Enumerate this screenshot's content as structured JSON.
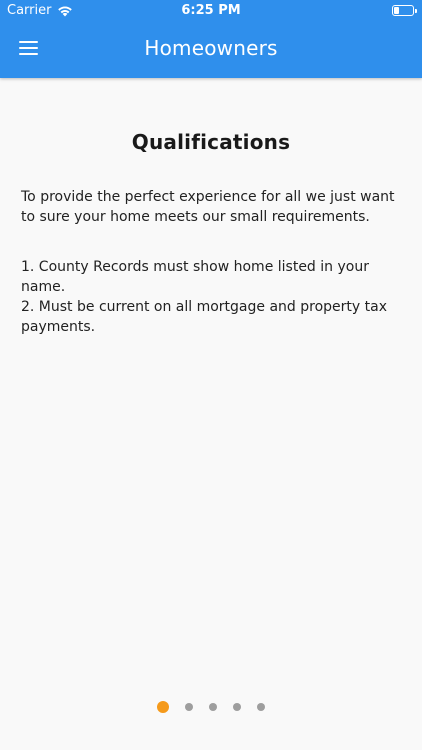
{
  "status_bar": {
    "carrier": "Carrier",
    "time": "6:25 PM",
    "wifi_icon": "wifi-icon",
    "battery_icon": "battery-icon"
  },
  "header": {
    "title": "Homeowners",
    "menu_icon": "hamburger-menu-icon",
    "background_color": "#2f8fec"
  },
  "page": {
    "title": "Qualifications",
    "intro": "To provide the perfect experience for all we just want to sure your home meets our small requirements.",
    "requirements": [
      "1. County Records must show home listed in your name.",
      "2. Must be current on all mortgage and property tax payments."
    ]
  },
  "pager": {
    "page_count": 5,
    "active_index": 0,
    "active_color": "#f59a1b",
    "inactive_color": "#9e9e9e"
  }
}
